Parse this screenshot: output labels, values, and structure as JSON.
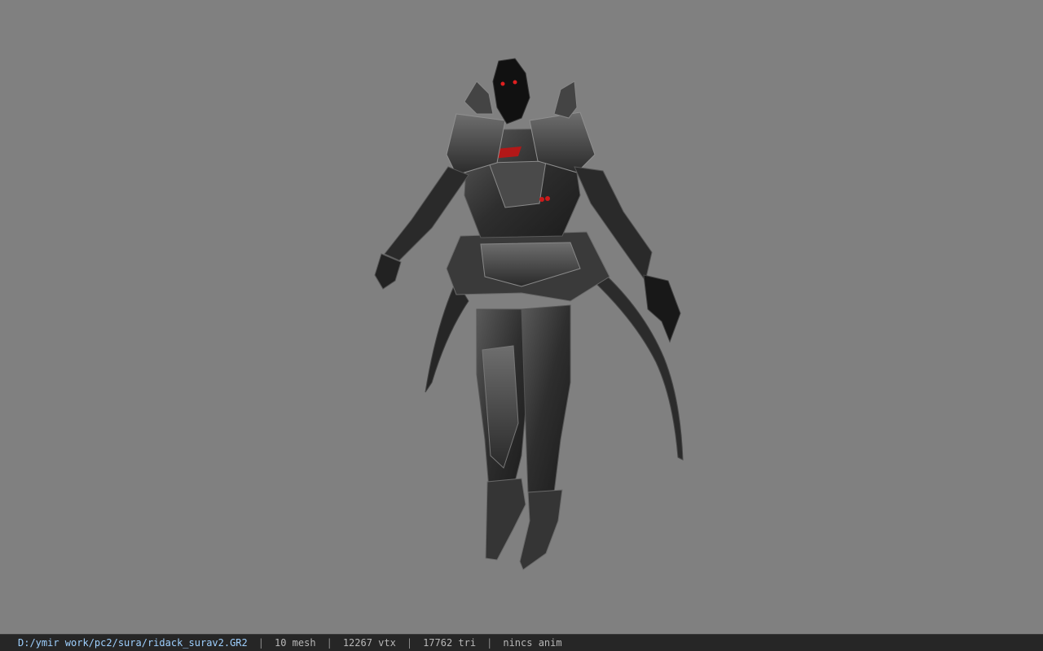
{
  "viewport": {
    "background": "#808080",
    "model_name": "sura-model-render"
  },
  "status_bar": {
    "file_path": "D:/ymir work/pc2/sura/ridack_surav2.GR2",
    "separator": "|",
    "mesh": "10 mesh",
    "vertices": "12267 vtx",
    "triangles": "17762 tri",
    "animation": "nincs anim",
    "colors": {
      "background": "#262626",
      "path": "#9ed0ff",
      "text": "#b8b8b8"
    }
  }
}
